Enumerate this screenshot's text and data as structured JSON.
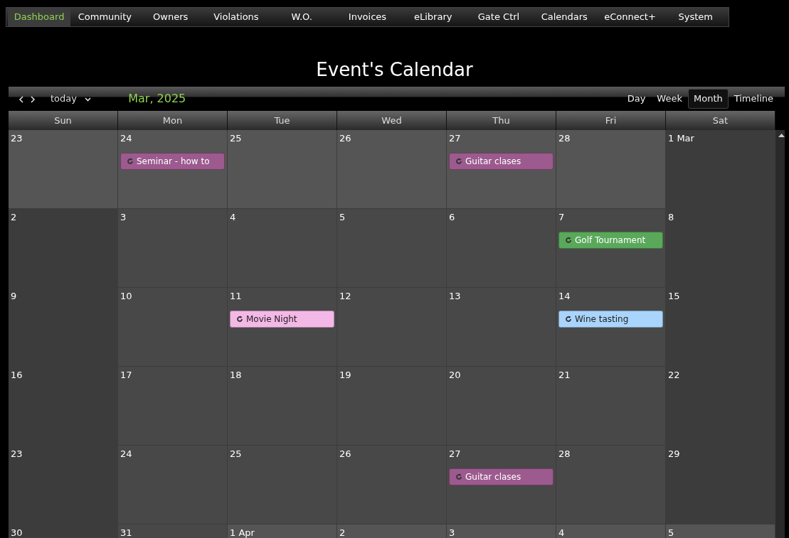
{
  "nav": [
    {
      "label": "Dashboard",
      "selected": true
    },
    {
      "label": "Community",
      "selected": false
    },
    {
      "label": "Owners",
      "selected": false
    },
    {
      "label": "Violations",
      "selected": false
    },
    {
      "label": "W.O.",
      "selected": false
    },
    {
      "label": "Invoices",
      "selected": false
    },
    {
      "label": "eLibrary",
      "selected": false
    },
    {
      "label": "Gate Ctrl",
      "selected": false
    },
    {
      "label": "Calendars",
      "selected": false
    },
    {
      "label": "eConnect+",
      "selected": false
    },
    {
      "label": "System",
      "selected": false
    }
  ],
  "title": "Event's Calendar",
  "toolbar": {
    "today": "today",
    "period": "Mar, 2025",
    "views": [
      {
        "label": "Day",
        "selected": false
      },
      {
        "label": "Week",
        "selected": false
      },
      {
        "label": "Month",
        "selected": true
      },
      {
        "label": "Timeline",
        "selected": false
      }
    ]
  },
  "weekdays": [
    "Sun",
    "Mon",
    "Tue",
    "Wed",
    "Thu",
    "Fri",
    "Sat"
  ],
  "weeks": [
    [
      {
        "day": "23",
        "other_month": true
      },
      {
        "day": "24",
        "other_month": true,
        "events": [
          {
            "title": "Seminar - how to",
            "color": "#9c5a8e"
          }
        ]
      },
      {
        "day": "25",
        "other_month": true
      },
      {
        "day": "26",
        "other_month": true
      },
      {
        "day": "27",
        "other_month": true,
        "events": [
          {
            "title": "Guitar clases",
            "color": "#9c5a8e"
          }
        ]
      },
      {
        "day": "28",
        "other_month": true
      },
      {
        "day": "1 Mar",
        "other_month": false
      }
    ],
    [
      {
        "day": "2",
        "other_month": false
      },
      {
        "day": "3",
        "other_month": false
      },
      {
        "day": "4",
        "other_month": false
      },
      {
        "day": "5",
        "other_month": false
      },
      {
        "day": "6",
        "other_month": false
      },
      {
        "day": "7",
        "other_month": false,
        "events": [
          {
            "title": "Golf Tournament",
            "color": "#5aa85a"
          }
        ]
      },
      {
        "day": "8",
        "other_month": false
      }
    ],
    [
      {
        "day": "9",
        "other_month": false
      },
      {
        "day": "10",
        "other_month": false
      },
      {
        "day": "11",
        "other_month": false,
        "events": [
          {
            "title": "Movie Night",
            "color": "#f4b8e6"
          }
        ]
      },
      {
        "day": "12",
        "other_month": false
      },
      {
        "day": "13",
        "other_month": false
      },
      {
        "day": "14",
        "other_month": false,
        "events": [
          {
            "title": "Wine tasting",
            "color": "#a9d4fb"
          }
        ]
      },
      {
        "day": "15",
        "other_month": false
      }
    ],
    [
      {
        "day": "16",
        "other_month": false
      },
      {
        "day": "17",
        "other_month": false
      },
      {
        "day": "18",
        "other_month": false
      },
      {
        "day": "19",
        "other_month": false
      },
      {
        "day": "20",
        "other_month": false
      },
      {
        "day": "21",
        "other_month": false
      },
      {
        "day": "22",
        "other_month": false
      }
    ],
    [
      {
        "day": "23",
        "other_month": false
      },
      {
        "day": "24",
        "other_month": false
      },
      {
        "day": "25",
        "other_month": false
      },
      {
        "day": "26",
        "other_month": false
      },
      {
        "day": "27",
        "other_month": false,
        "events": [
          {
            "title": "Guitar clases",
            "color": "#9c5a8e"
          }
        ]
      },
      {
        "day": "28",
        "other_month": false
      },
      {
        "day": "29",
        "other_month": false
      }
    ],
    [
      {
        "day": "30",
        "other_month": false
      },
      {
        "day": "31",
        "other_month": false
      },
      {
        "day": "1 Apr",
        "other_month": true
      },
      {
        "day": "2",
        "other_month": true
      },
      {
        "day": "3",
        "other_month": true
      },
      {
        "day": "4",
        "other_month": true
      },
      {
        "day": "5",
        "other_month": true
      }
    ]
  ]
}
